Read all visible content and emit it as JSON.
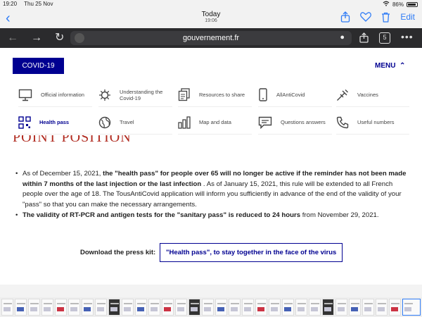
{
  "status_bar": {
    "time": "19:20",
    "date": "Thu 25 Nov",
    "battery": "86%"
  },
  "header": {
    "title": "Today",
    "subtitle": "19:06",
    "edit_label": "Edit"
  },
  "browser": {
    "url": "gouvernement.fr",
    "tab_count": "5"
  },
  "page": {
    "covid_button": "COVID-19",
    "menu_label": "MENU",
    "nav": [
      {
        "label": "Official information",
        "icon": "monitor-icon"
      },
      {
        "label": "Understanding the Covid-19",
        "icon": "virus-icon"
      },
      {
        "label": "Resources to share",
        "icon": "documents-icon"
      },
      {
        "label": "AllAntiCovid",
        "icon": "phone-icon"
      },
      {
        "label": "Vaccines",
        "icon": "syringe-icon"
      },
      {
        "label": "Health pass",
        "icon": "qr-code-icon",
        "active": true
      },
      {
        "label": "Travel",
        "icon": "globe-icon"
      },
      {
        "label": "Map and data",
        "icon": "bar-chart-icon"
      },
      {
        "label": "Questions answers",
        "icon": "chat-icon"
      },
      {
        "label": "Useful numbers",
        "icon": "phone-handset-icon"
      }
    ],
    "heading": "POINT POSITION",
    "bullets": [
      {
        "p1": "As of December 15, 2021, ",
        "b1": "the \"health pass\" for people over 65 will no longer be active if the reminder has not been made within 7 months of the last injection or the last infection",
        "p2": " . As of January 15, 2021, this rule will be extended to all French people over the age of 18. The TousAntiCovid application will inform you sufficiently in advance of the end of the validity of your \"pass\" so that you can make the necessary arrangements."
      },
      {
        "b1": "The validity of RT-PCR and antigen tests for the \"sanitary pass\" is reduced to 24 hours",
        "p2": " from November 29, 2021."
      }
    ],
    "press_label": "Download the press kit:",
    "press_button": "\"Health pass\", to stay together in the face of the virus"
  },
  "colors": {
    "brand_blue": "#000091",
    "heading_red": "#b02a1f",
    "ios_blue": "#2f7cf6"
  }
}
